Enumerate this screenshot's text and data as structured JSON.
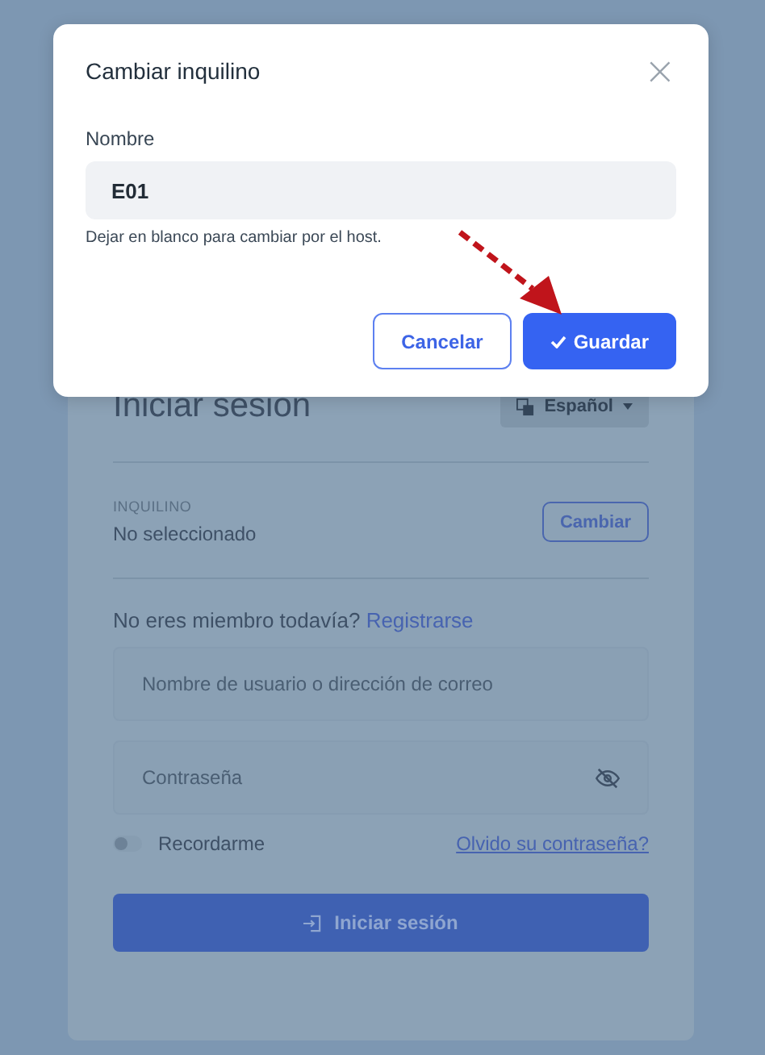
{
  "login": {
    "title": "Iniciar sesion",
    "language": "Español",
    "tenant": {
      "label": "INQUILINO",
      "value": "No seleccionado",
      "button": "Cambiar"
    },
    "register": {
      "text": "No eres miembro todavía?",
      "link": "Registrarse"
    },
    "username": {
      "placeholder": "Nombre de usuario o dirección de correo"
    },
    "password": {
      "placeholder": "Contraseña"
    },
    "remember": {
      "label": "Recordarme",
      "on": false
    },
    "forgot": "Olvido su contraseña?",
    "submit": "Iniciar sesión"
  },
  "dialog": {
    "title": "Cambiar inquilino",
    "close": "×",
    "field_label": "Nombre",
    "value": "E01",
    "hint": "Dejar en blanco para cambiar por el host.",
    "buttons": [
      {
        "kind": "secondary",
        "label": "Cancelar"
      },
      {
        "kind": "primary",
        "label": "Guardar"
      }
    ]
  }
}
